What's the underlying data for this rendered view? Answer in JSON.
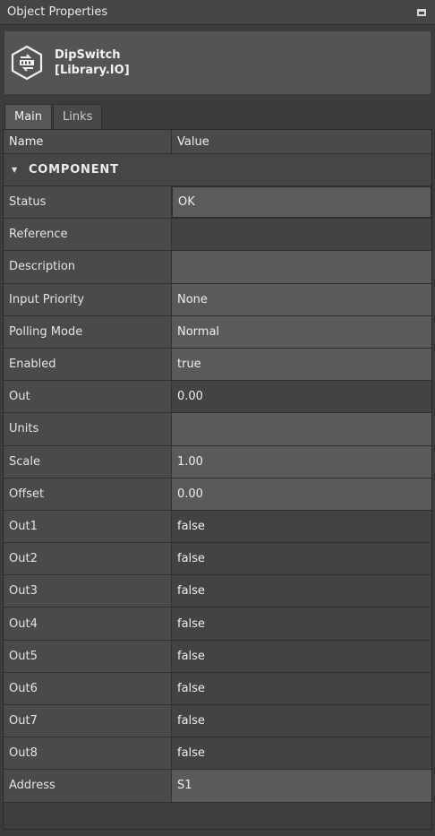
{
  "panel": {
    "title": "Object Properties"
  },
  "object": {
    "name": "DipSwitch",
    "type": "[Library.IO]"
  },
  "tabs": [
    {
      "label": "Main",
      "active": true
    },
    {
      "label": "Links",
      "active": false
    }
  ],
  "grid": {
    "header": {
      "name": "Name",
      "value": "Value"
    },
    "section": "COMPONENT",
    "rows": [
      {
        "name": "Status",
        "value": "OK",
        "style": "light"
      },
      {
        "name": "Reference",
        "value": "",
        "style": "dark"
      },
      {
        "name": "Description",
        "value": "",
        "style": "light"
      },
      {
        "name": "Input Priority",
        "value": "None",
        "style": "light"
      },
      {
        "name": "Polling Mode",
        "value": "Normal",
        "style": "light"
      },
      {
        "name": "Enabled",
        "value": "true",
        "style": "light"
      },
      {
        "name": "Out",
        "value": "0.00",
        "style": "dark"
      },
      {
        "name": "Units",
        "value": "",
        "style": "light"
      },
      {
        "name": "Scale",
        "value": "1.00",
        "style": "light"
      },
      {
        "name": "Offset",
        "value": "0.00",
        "style": "light"
      },
      {
        "name": "Out1",
        "value": "false",
        "style": "dark"
      },
      {
        "name": "Out2",
        "value": "false",
        "style": "dark"
      },
      {
        "name": "Out3",
        "value": "false",
        "style": "dark"
      },
      {
        "name": "Out4",
        "value": "false",
        "style": "dark"
      },
      {
        "name": "Out5",
        "value": "false",
        "style": "dark"
      },
      {
        "name": "Out6",
        "value": "false",
        "style": "dark"
      },
      {
        "name": "Out7",
        "value": "false",
        "style": "dark"
      },
      {
        "name": "Out8",
        "value": "false",
        "style": "dark"
      },
      {
        "name": "Address",
        "value": "S1",
        "style": "light"
      }
    ]
  }
}
